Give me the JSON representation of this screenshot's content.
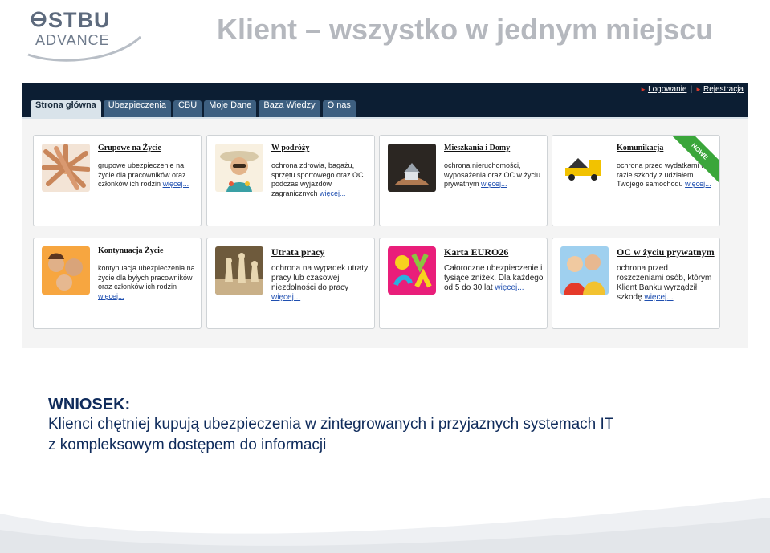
{
  "slide": {
    "title": "Klient – wszystko w jednym miejscu",
    "logo_line1": "STBU",
    "logo_line2": "ADVANCE"
  },
  "site": {
    "top_links": [
      "Logowanie",
      "Rejestracja"
    ],
    "tabs": [
      "Strona główna",
      "Ubezpieczenia",
      "CBU",
      "Moje Dane",
      "Baza Wiedzy",
      "O nas"
    ],
    "active_tab": "Strona główna",
    "more_label": "więcej...",
    "cards": [
      {
        "title": "Grupowe na Życie",
        "desc": "grupowe ubezpieczenie na życie dla pracowników oraz członków ich rodzin"
      },
      {
        "title": "W podróży",
        "desc": "ochrona zdrowia, bagażu, sprzętu sportowego oraz OC podczas wyjazdów zagranicznych"
      },
      {
        "title": "Mieszkania i Domy",
        "desc": "ochrona nieruchomości, wyposażenia oraz OC w życiu prywatnym"
      },
      {
        "title": "Komunikacja",
        "desc": "ochrona przed wydatkami w razie szkody z udziałem Twojego samochodu",
        "badge": "NOWE"
      },
      {
        "title": "Kontynuacja Życie",
        "desc": "kontynuacja ubezpieczenia na życie dla byłych pracowników oraz członków ich rodzin"
      },
      {
        "title": "Utrata pracy",
        "desc": "ochrona na wypadek utraty pracy lub czasowej niezdolności do pracy"
      },
      {
        "title": "Karta EURO26",
        "desc": "Całoroczne ubezpieczenie i tysiące zniżek. Dla każdego od 5 do 30 lat"
      },
      {
        "title": "OC w życiu prywatnym",
        "desc": "ochrona przed roszczeniami osób, którym Klient Banku wyrządził szkodę"
      }
    ]
  },
  "conclusion": {
    "heading": "WNIOSEK:",
    "line1": "Klienci chętniej kupują ubezpieczenia w zintegrowanych i przyjaznych  systemach  IT",
    "line2": "z kompleksowym dostępem do informacji"
  },
  "colors": {
    "navy": "#0c1e33",
    "tab": "#3d5f80",
    "tab_active": "#d9e3ea",
    "title_gray": "#b5b8be",
    "conclusion_blue": "#0f2b5b",
    "badge_green": "#3aa63a"
  },
  "icons": [
    "stbu-logo-icon",
    "hands-photo",
    "traveler-photo",
    "house-hands-photo",
    "tow-truck-photo",
    "family-photo",
    "chess-photo",
    "eyca-logo",
    "happy-family-photo"
  ]
}
